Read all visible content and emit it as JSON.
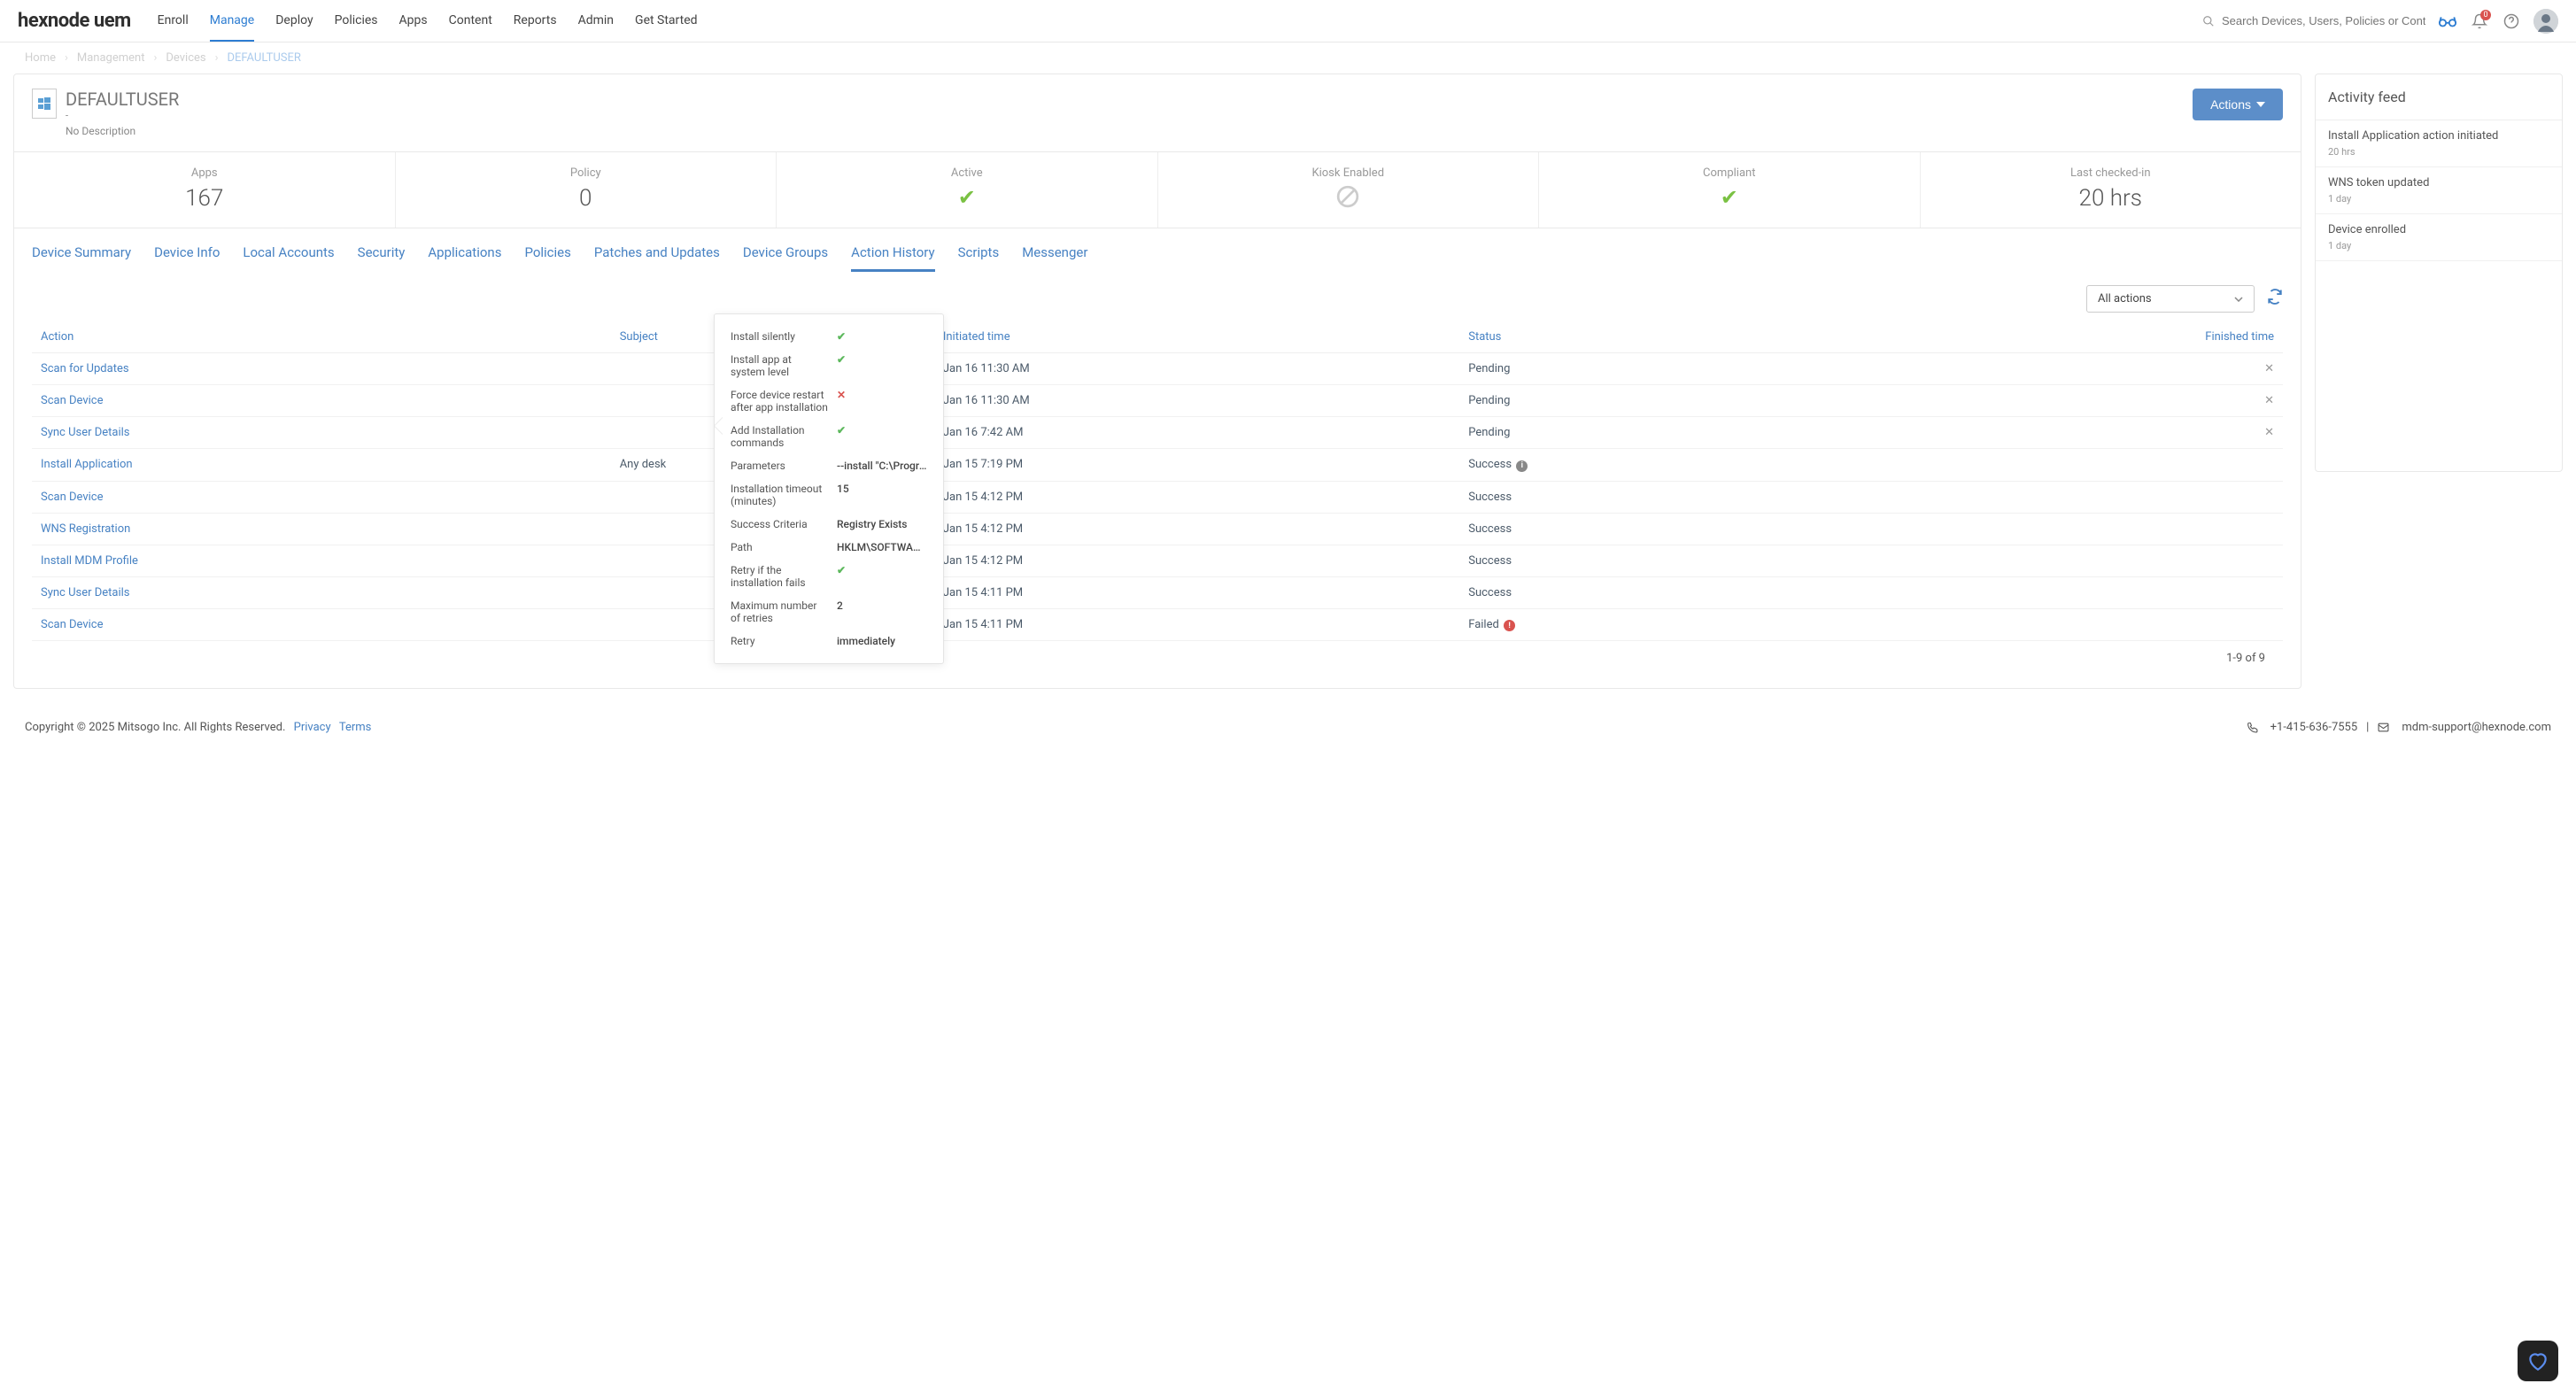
{
  "brand": "hexnode uem",
  "navTabs": [
    "Enroll",
    "Manage",
    "Deploy",
    "Policies",
    "Apps",
    "Content",
    "Reports",
    "Admin",
    "Get Started"
  ],
  "navActiveIndex": 1,
  "searchPlaceholder": "Search Devices, Users, Policies or Content",
  "notifCount": "0",
  "breadcrumb": {
    "home": "Home",
    "mgmt": "Management",
    "devices": "Devices",
    "current": "DEFAULTUSER"
  },
  "device": {
    "name": "DEFAULTUSER",
    "sub": "-",
    "desc": "No Description",
    "actionsLabel": "Actions"
  },
  "kpis": [
    {
      "label": "Apps",
      "value": "167",
      "type": "text"
    },
    {
      "label": "Policy",
      "value": "0",
      "type": "text"
    },
    {
      "label": "Active",
      "type": "check"
    },
    {
      "label": "Kiosk Enabled",
      "type": "ban"
    },
    {
      "label": "Compliant",
      "type": "check"
    },
    {
      "label": "Last checked-in",
      "value": "20 hrs",
      "type": "text"
    }
  ],
  "subTabs": [
    "Device Summary",
    "Device Info",
    "Local Accounts",
    "Security",
    "Applications",
    "Policies",
    "Patches and Updates",
    "Device Groups",
    "Action History",
    "Scripts",
    "Messenger"
  ],
  "subActiveIndex": 8,
  "filterLabel": "All actions",
  "tableHeaders": [
    "Action",
    "Subject",
    "Initiated time",
    "Status",
    "Finished time"
  ],
  "rows": [
    {
      "action": "Scan for Updates",
      "subject": "",
      "initiated": "Jan 16 11:30 AM",
      "status": "Pending",
      "finished": "",
      "close": true
    },
    {
      "action": "Scan Device",
      "subject": "",
      "initiated": "Jan 16 11:30 AM",
      "status": "Pending",
      "finished": "",
      "close": true
    },
    {
      "action": "Sync User Details",
      "subject": "",
      "initiated": "Jan 16 7:42 AM",
      "status": "Pending",
      "finished": "",
      "close": true
    },
    {
      "action": "Install Application",
      "subject": "Any desk",
      "initiated": "Jan 15 7:19 PM",
      "status": "Success",
      "finished": "",
      "info": true
    },
    {
      "action": "Scan Device",
      "subject": "",
      "initiated": "Jan 15 4:12 PM",
      "status": "Success",
      "finished": ""
    },
    {
      "action": "WNS Registration",
      "subject": "",
      "initiated": "Jan 15 4:12 PM",
      "status": "Success",
      "finished": ""
    },
    {
      "action": "Install MDM Profile",
      "subject": "",
      "initiated": "Jan 15 4:12 PM",
      "status": "Success",
      "finished": ""
    },
    {
      "action": "Sync User Details",
      "subject": "",
      "initiated": "Jan 15 4:11 PM",
      "status": "Success",
      "finished": ""
    },
    {
      "action": "Scan Device",
      "subject": "",
      "initiated": "Jan 15 4:11 PM",
      "status": "Failed",
      "finished": "",
      "err": true
    }
  ],
  "pagination": "1-9 of 9",
  "popover": [
    {
      "label": "Install silently",
      "type": "check"
    },
    {
      "label": "Install app at system level",
      "type": "check"
    },
    {
      "label": "Force device restart after app installation",
      "type": "cross"
    },
    {
      "label": "Add Installation commands",
      "type": "check"
    },
    {
      "label": "Parameters",
      "val": "--install \"C:\\Program F..."
    },
    {
      "label": "Installation timeout (minutes)",
      "val": "15"
    },
    {
      "label": "Success Criteria",
      "val": "Registry Exists"
    },
    {
      "label": "Path",
      "val": "HKLM\\SOFTWARE\\..."
    },
    {
      "label": "Retry if the installation fails",
      "type": "check"
    },
    {
      "label": "Maximum number of retries",
      "val": "2"
    },
    {
      "label": "Retry",
      "val": "immediately"
    }
  ],
  "activity": {
    "title": "Activity feed",
    "items": [
      {
        "t": "Install Application action initiated",
        "s": "20 hrs"
      },
      {
        "t": "WNS token updated",
        "s": "1 day"
      },
      {
        "t": "Device enrolled",
        "s": "1 day"
      }
    ]
  },
  "footer": {
    "copyright": "Copyright © 2025 Mitsogo Inc. All Rights Reserved.",
    "privacy": "Privacy",
    "terms": "Terms",
    "phone": "+1-415-636-7555",
    "divider": "|",
    "email": "mdm-support@hexnode.com"
  }
}
